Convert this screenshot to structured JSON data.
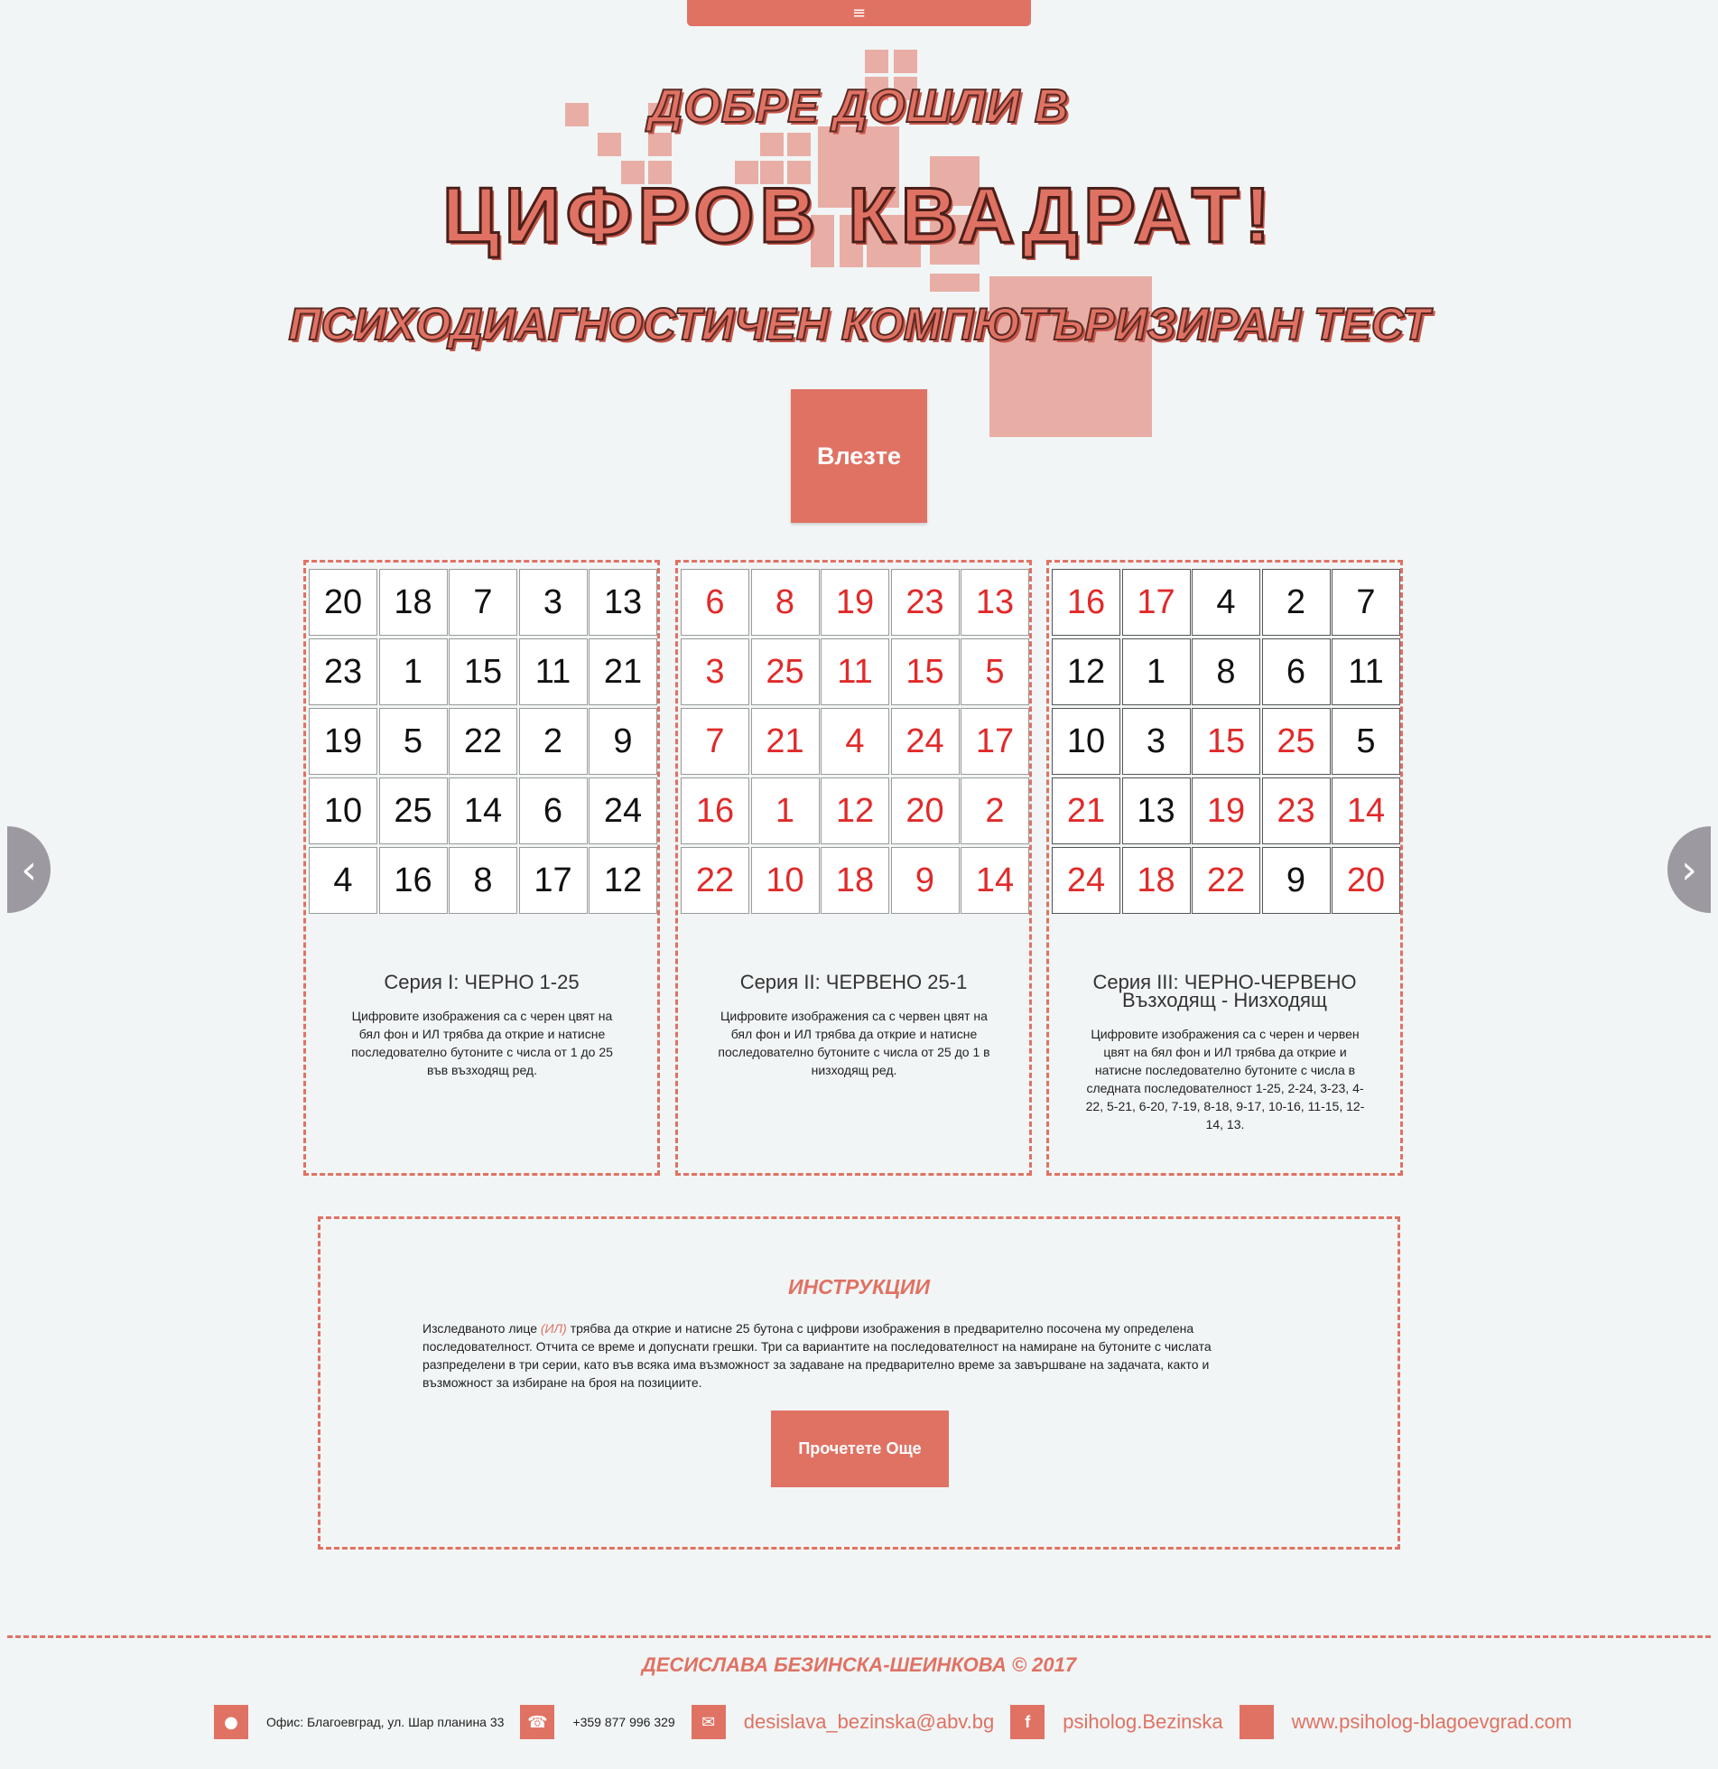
{
  "menu": {
    "icon": "hamburger-icon",
    "glyph": "≡"
  },
  "hero": {
    "line1": "ДОБРЕ ДОШЛИ В",
    "line2": "ЦИФРОВ КВАДРАТ!",
    "line3": "ПСИХОДИАГНОСТИЧЕН КОМПЮТЪРИЗИРАН ТЕСТ",
    "enter_label": "Влезте"
  },
  "carousel": {
    "prev_glyph": "‹",
    "next_glyph": "›"
  },
  "series": [
    {
      "title": "Серия I: ЧЕРНО 1-25",
      "description": "Цифровите изображения са с черен цвят на бял фон и ИЛ трябва да открие и натисне последователно бутоните с числа от 1 до 25 във възходящ ред.",
      "cells": [
        {
          "n": "20",
          "c": "black"
        },
        {
          "n": "18",
          "c": "black"
        },
        {
          "n": "7",
          "c": "black"
        },
        {
          "n": "3",
          "c": "black"
        },
        {
          "n": "13",
          "c": "black"
        },
        {
          "n": "23",
          "c": "black"
        },
        {
          "n": "1",
          "c": "black"
        },
        {
          "n": "15",
          "c": "black"
        },
        {
          "n": "11",
          "c": "black"
        },
        {
          "n": "21",
          "c": "black"
        },
        {
          "n": "19",
          "c": "black"
        },
        {
          "n": "5",
          "c": "black"
        },
        {
          "n": "22",
          "c": "black"
        },
        {
          "n": "2",
          "c": "black"
        },
        {
          "n": "9",
          "c": "black"
        },
        {
          "n": "10",
          "c": "black"
        },
        {
          "n": "25",
          "c": "black"
        },
        {
          "n": "14",
          "c": "black"
        },
        {
          "n": "6",
          "c": "black"
        },
        {
          "n": "24",
          "c": "black"
        },
        {
          "n": "4",
          "c": "black"
        },
        {
          "n": "16",
          "c": "black"
        },
        {
          "n": "8",
          "c": "black"
        },
        {
          "n": "17",
          "c": "black"
        },
        {
          "n": "12",
          "c": "black"
        }
      ]
    },
    {
      "title": "Серия II: ЧЕРВЕНО 25-1",
      "description": "Цифровите изображения са с червен цвят на бял фон и ИЛ трябва да открие и натисне последователно бутоните с числа от 25 до 1 в низходящ ред.",
      "cells": [
        {
          "n": "6",
          "c": "red"
        },
        {
          "n": "8",
          "c": "red"
        },
        {
          "n": "19",
          "c": "red"
        },
        {
          "n": "23",
          "c": "red"
        },
        {
          "n": "13",
          "c": "red"
        },
        {
          "n": "3",
          "c": "red"
        },
        {
          "n": "25",
          "c": "red"
        },
        {
          "n": "11",
          "c": "red"
        },
        {
          "n": "15",
          "c": "red"
        },
        {
          "n": "5",
          "c": "red"
        },
        {
          "n": "7",
          "c": "red"
        },
        {
          "n": "21",
          "c": "red"
        },
        {
          "n": "4",
          "c": "red"
        },
        {
          "n": "24",
          "c": "red"
        },
        {
          "n": "17",
          "c": "red"
        },
        {
          "n": "16",
          "c": "red"
        },
        {
          "n": "1",
          "c": "red"
        },
        {
          "n": "12",
          "c": "red"
        },
        {
          "n": "20",
          "c": "red"
        },
        {
          "n": "2",
          "c": "red"
        },
        {
          "n": "22",
          "c": "red"
        },
        {
          "n": "10",
          "c": "red"
        },
        {
          "n": "18",
          "c": "red"
        },
        {
          "n": "9",
          "c": "red"
        },
        {
          "n": "14",
          "c": "red"
        }
      ]
    },
    {
      "title": "Серия III: ЧЕРНО-ЧЕРВЕНО Възходящ - Низходящ",
      "description": "Цифровите изображения са с черен и червен цвят на бял фон и ИЛ трябва да открие и натисне последователно бутоните с числа в следната последователност 1-25, 2-24, 3-23, 4-22, 5-21, 6-20, 7-19, 8-18, 9-17, 10-16, 11-15, 12-14, 13.",
      "cells": [
        {
          "n": "16",
          "c": "red"
        },
        {
          "n": "17",
          "c": "red"
        },
        {
          "n": "4",
          "c": "black"
        },
        {
          "n": "2",
          "c": "black"
        },
        {
          "n": "7",
          "c": "black"
        },
        {
          "n": "12",
          "c": "black"
        },
        {
          "n": "1",
          "c": "black"
        },
        {
          "n": "8",
          "c": "black"
        },
        {
          "n": "6",
          "c": "black"
        },
        {
          "n": "11",
          "c": "black"
        },
        {
          "n": "10",
          "c": "black"
        },
        {
          "n": "3",
          "c": "black"
        },
        {
          "n": "15",
          "c": "red"
        },
        {
          "n": "25",
          "c": "red"
        },
        {
          "n": "5",
          "c": "black"
        },
        {
          "n": "21",
          "c": "red"
        },
        {
          "n": "13",
          "c": "black"
        },
        {
          "n": "19",
          "c": "red"
        },
        {
          "n": "23",
          "c": "red"
        },
        {
          "n": "14",
          "c": "red"
        },
        {
          "n": "24",
          "c": "red"
        },
        {
          "n": "18",
          "c": "red"
        },
        {
          "n": "22",
          "c": "red"
        },
        {
          "n": "9",
          "c": "black"
        },
        {
          "n": "20",
          "c": "red"
        }
      ]
    }
  ],
  "instructions": {
    "title": "ИНСТРУКЦИИ",
    "text_before": "Изследваното лице ",
    "highlight": "(ИЛ)",
    "text_after": " трябва да открие и натисне 25 бутона с цифрови изображения в предварително посочена му определена последователност. Отчита се време и допуснати грешки. Три са вариантите на последователност на намиране на бутоните с числата разпределени в три серии, като във всяка има възможност за задаване на предварително време за завършване на задачата, както и възможност за избиране на броя на позициите.",
    "button_label": "Прочетете Още"
  },
  "footer": {
    "name": "ДЕСИСЛАВА БЕЗИНСКА-ШЕИНКОВА © 2017",
    "address": "Офис: Благоевград, ул. Шар планина 33",
    "phone": "+359 877 996 329",
    "email": "desislava_bezinska@abv.bg",
    "facebook": "psiholog.Bezinska",
    "website": "www.psiholog-blagoevgrad.com",
    "icons": [
      "location-pin-icon",
      "phone-icon",
      "envelope-icon",
      "facebook-icon",
      "web-icon"
    ]
  },
  "colors": {
    "accent": "#e07264",
    "red_digit": "#e02a2a",
    "background": "#f1f5f5",
    "arrow": "#9c9aa0"
  }
}
